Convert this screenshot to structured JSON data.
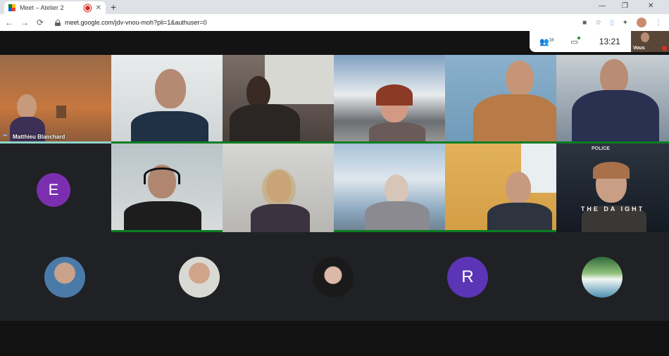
{
  "browser": {
    "tab_title": "Meet – Atelier 2",
    "tab_close": "✕",
    "new_tab": "+",
    "url": "meet.google.com/jdv-vnou-moh?pli=1&authuser=0",
    "nav_back": "←",
    "nav_forward": "→",
    "nav_reload": "⟳",
    "window_minimize": "—",
    "window_restore": "❐",
    "window_close": "✕"
  },
  "meeting": {
    "participant_count": "18",
    "time": "13:21",
    "self_label": "Vous"
  },
  "tiles": [
    {
      "name": "Matthieu Blanchard",
      "speaking": true
    },
    {
      "name": ""
    },
    {
      "name": ""
    },
    {
      "name": ""
    },
    {
      "name": ""
    },
    {
      "name": ""
    },
    {
      "name": ""
    },
    {
      "name": ""
    },
    {
      "name": ""
    },
    {
      "name": ""
    },
    {
      "name": "",
      "overlay_text": "THE DA  IGHT",
      "overlay_top": "POLICE"
    }
  ],
  "letter_avatars": {
    "e": {
      "letter": "E",
      "color": "#7b2fb0"
    },
    "r": {
      "letter": "R",
      "color": "#5b35b5"
    }
  },
  "colors": {
    "active_border": "#0b7d22",
    "speaking_bar": "#8fd3c7",
    "accent_blue": "#8ab4f8"
  }
}
